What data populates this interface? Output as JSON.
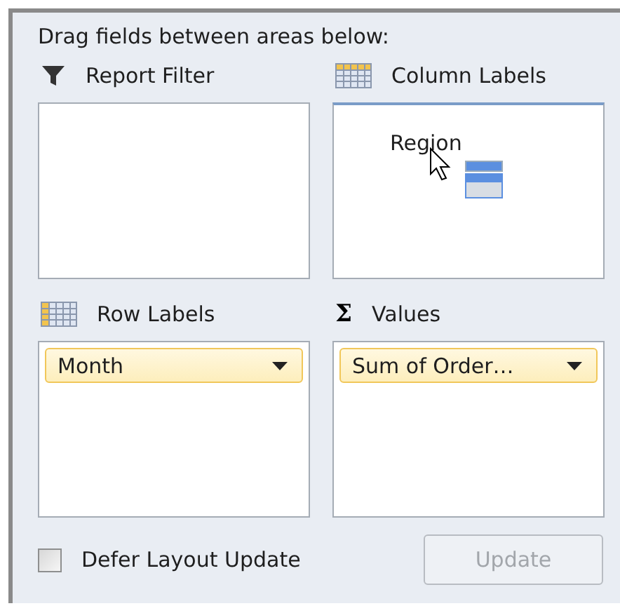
{
  "instruction": "Drag fields between areas below:",
  "areas": [
    {
      "kind": "filter",
      "label": "Report Filter"
    },
    {
      "kind": "columns",
      "label": "Column Labels",
      "fields": [
        {
          "kind": "dragging",
          "name": "Region"
        }
      ]
    },
    {
      "kind": "rows",
      "label": "Row Labels",
      "fields": [
        {
          "kind": "pill",
          "name": "Month"
        }
      ]
    },
    {
      "kind": "values",
      "label": "Values",
      "icon_text": "Σ",
      "fields": [
        {
          "kind": "pill",
          "name": "Sum of Order…"
        }
      ]
    }
  ],
  "defer": {
    "label": "Defer Layout Update",
    "checked": false
  },
  "update_button": {
    "label": "Update",
    "disabled": true
  }
}
